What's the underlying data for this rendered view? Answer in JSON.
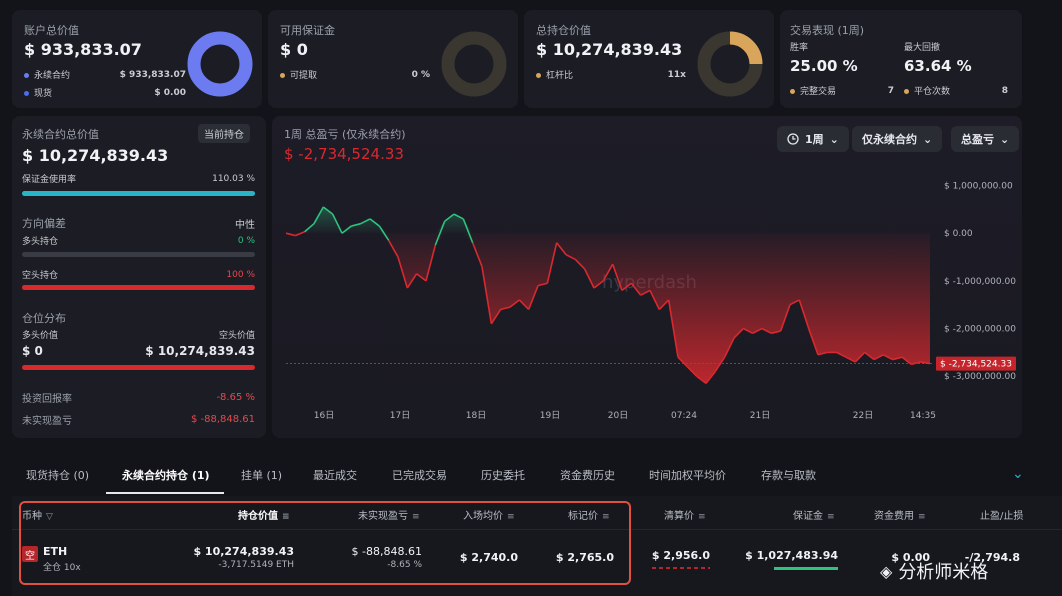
{
  "summary": {
    "account": {
      "title": "账户总价值",
      "value": "$ 933,833.07",
      "rows": [
        {
          "label": "永续合约",
          "value": "$ 933,833.07",
          "color": "#6c7cf0"
        },
        {
          "label": "现货",
          "value": "$ 0.00",
          "color": "#4a6cf0"
        }
      ]
    },
    "margin": {
      "title": "可用保证金",
      "value": "$ 0",
      "rows": [
        {
          "label": "可提取",
          "value": "0 %",
          "color": "#d9a55a"
        }
      ]
    },
    "holdings": {
      "title": "总持仓价值",
      "value": "$ 10,274,839.43",
      "rows": [
        {
          "label": "杠杆比",
          "value": "11x",
          "color": "#d9a55a"
        }
      ]
    },
    "performance": {
      "title": "交易表现 (1周)",
      "win_label": "胜率",
      "win_value": "25.00 %",
      "dd_label": "最大回撤",
      "dd_value": "63.64 %",
      "rows": [
        {
          "label": "完整交易",
          "value": "7",
          "color": "#d9a55a"
        },
        {
          "label": "平仓次数",
          "value": "8",
          "color": "#d9a55a"
        }
      ]
    }
  },
  "left": {
    "title": "永续合约总价值",
    "badge": "当前持仓",
    "value": "$ 10,274,839.43",
    "margin_label": "保证金使用率",
    "margin_value": "110.03 %",
    "margin_fraction": 1.0,
    "bias_label": "方向偏差",
    "bias_value": "中性",
    "long_label": "多头持仓",
    "long_value": "0 %",
    "long_fraction": 0,
    "short_label": "空头持仓",
    "short_value": "100 %",
    "short_fraction": 1.0,
    "dist_label": "仓位分布",
    "long_val_label": "多头价值",
    "short_val_label": "空头价值",
    "long_val": "$ 0",
    "short_val": "$ 10,274,839.43",
    "roi_label": "投资回报率",
    "roi_value": "-8.65 %",
    "upnl_label": "未实现盈亏",
    "upnl_value": "$ -88,848.61"
  },
  "chart_header": {
    "title": "1周 总盈亏 (仅永续合约)",
    "value": "$ -2,734,524.33",
    "btn_period": "1周",
    "btn_scope": "仅永续合约",
    "btn_metric": "总盈亏",
    "watermark": "hyperdash"
  },
  "chart_data": {
    "type": "area",
    "x_ticks": [
      "16日",
      "17日",
      "18日",
      "19日",
      "20日",
      "07:24",
      "21日",
      "22日",
      "14:35"
    ],
    "y_ticks": [
      "$ 1,000,000.00",
      "$ 0.00",
      "$ -1,000,000.00",
      "$ -2,000,000.00",
      "$ -3,000,000.00"
    ],
    "ylim": [
      -3100000,
      1200000
    ],
    "current_label": "$ -2,734,524.33",
    "current": -2734524.33,
    "values": [
      0,
      -50000,
      30000,
      200000,
      550000,
      400000,
      0,
      150000,
      200000,
      300000,
      150000,
      -150000,
      -500000,
      -1150000,
      -850000,
      -1000000,
      -250000,
      250000,
      400000,
      300000,
      -200000,
      -700000,
      -1900000,
      -1600000,
      -1550000,
      -1400000,
      -1600000,
      -1100000,
      -1050000,
      -200000,
      -450000,
      -550000,
      -750000,
      -1150000,
      -1000000,
      -650000,
      -1200000,
      -1050000,
      -1300000,
      -1200000,
      -1600000,
      -1400000,
      -2600000,
      -2800000,
      -3000000,
      -3150000,
      -2900000,
      -2600000,
      -2200000,
      -2000000,
      -2100000,
      -2000000,
      -2100000,
      -2050000,
      -1500000,
      -1400000,
      -2000000,
      -2550000,
      -2500000,
      -2500000,
      -2600000,
      -2700000,
      -2500000,
      -2650000,
      -2550000,
      -2650000,
      -2600000,
      -2750000,
      -2700000,
      -2734524
    ]
  },
  "tabs": [
    {
      "label": "现货持仓 (0)",
      "active": false
    },
    {
      "label": "永续合约持仓 (1)",
      "active": true
    },
    {
      "label": "挂单 (1)",
      "active": false
    },
    {
      "label": "最近成交",
      "active": false
    },
    {
      "label": "已完成交易",
      "active": false
    },
    {
      "label": "历史委托",
      "active": false
    },
    {
      "label": "资金费历史",
      "active": false
    },
    {
      "label": "时间加权平均价",
      "active": false
    },
    {
      "label": "存款与取款",
      "active": false
    }
  ],
  "table": {
    "headers": [
      "币种",
      "持仓价值",
      "未实现盈亏",
      "入场均价",
      "标记价",
      "清算价",
      "保证金",
      "资金费用",
      "止盈/止损"
    ],
    "row": {
      "side": "空",
      "coin": "ETH",
      "mode": "全仓 10x",
      "value": "$ 10,274,839.43",
      "size": "-3,717.5149 ETH",
      "upnl": "$ -88,848.61",
      "upnl_pct": "-8.65 %",
      "entry": "$ 2,740.0",
      "mark": "$ 2,765.0",
      "liq": "$ 2,956.0",
      "margin": "$ 1,027,483.94",
      "funding": "$ 0.00",
      "tpsl": "-/2,794.8"
    }
  },
  "watermark_text": "分析师米格"
}
